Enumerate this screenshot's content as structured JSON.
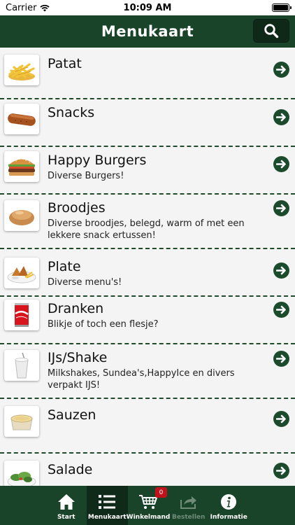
{
  "status_bar": {
    "carrier": "Carrier",
    "time": "10:09 AM"
  },
  "header": {
    "title": "Menukaart",
    "search_icon": "search-icon"
  },
  "colors": {
    "primary": "#19442a",
    "primary_dark": "#0f2918",
    "badge": "#c0121b",
    "background": "#f4f4f4"
  },
  "menu": {
    "items": [
      {
        "title": "Patat",
        "description": "",
        "image": "fries"
      },
      {
        "title": "Snacks",
        "description": "",
        "image": "frikandel"
      },
      {
        "title": "Happy Burgers",
        "description": "Diverse Burgers!",
        "image": "burger"
      },
      {
        "title": "Broodjes",
        "description": "Diverse broodjes, belegd, warm of met een lekkere snack ertussen!",
        "image": "bread-roll"
      },
      {
        "title": "Plate",
        "description": "Diverse menu's!",
        "image": "plate"
      },
      {
        "title": "Dranken",
        "description": "Blikje of toch een flesje?",
        "image": "cola-can"
      },
      {
        "title": "IJs/Shake",
        "description": "Milkshakes, Sundea's,HappyIce en divers verpakt IJS!",
        "image": "milkshake"
      },
      {
        "title": "Sauzen",
        "description": "",
        "image": "sauce-cup"
      },
      {
        "title": "Salade",
        "description": "",
        "image": "salad"
      }
    ]
  },
  "tab_bar": {
    "tabs": [
      {
        "label": "Start",
        "icon": "home-icon"
      },
      {
        "label": "Menukaart",
        "icon": "list-icon"
      },
      {
        "label": "Winkelmand",
        "icon": "cart-icon",
        "badge": "0"
      },
      {
        "label": "Bestellen",
        "icon": "share-icon"
      },
      {
        "label": "Informatie",
        "icon": "info-icon"
      }
    ]
  }
}
